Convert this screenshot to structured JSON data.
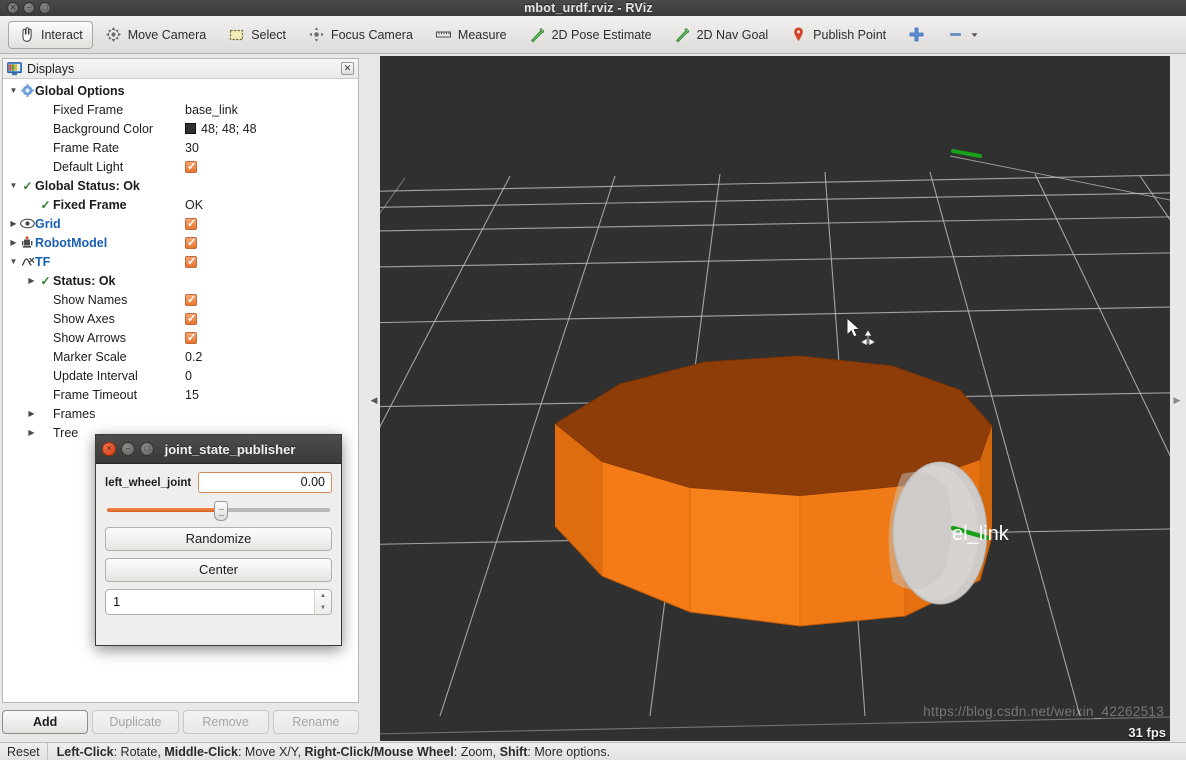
{
  "window": {
    "title": "mbot_urdf.rviz - RViz",
    "buttons": [
      "close",
      "minimize",
      "maximize"
    ]
  },
  "toolbar": {
    "items": [
      {
        "label": "Interact",
        "icon": "hand-cursor-icon",
        "active": true
      },
      {
        "label": "Move Camera",
        "icon": "move-camera-icon",
        "active": false
      },
      {
        "label": "Select",
        "icon": "select-rect-icon",
        "active": false
      },
      {
        "label": "Focus Camera",
        "icon": "focus-camera-icon",
        "active": false
      },
      {
        "label": "Measure",
        "icon": "measure-ruler-icon",
        "active": false
      },
      {
        "label": "2D Pose Estimate",
        "icon": "pose-arrow-icon",
        "active": false
      },
      {
        "label": "2D Nav Goal",
        "icon": "nav-goal-arrow-icon",
        "active": false
      },
      {
        "label": "Publish Point",
        "icon": "map-pin-icon",
        "active": false
      },
      {
        "label": "",
        "icon": "plus-cross-icon",
        "active": false
      },
      {
        "label": "",
        "icon": "toolbar-overflow-icon",
        "active": false
      }
    ]
  },
  "displays": {
    "title": "Displays",
    "close_glyph": "✕",
    "rows": [
      {
        "indent": 0,
        "arrow": "▼",
        "icon": "gear-icon",
        "label": "Global Options",
        "value_type": "none",
        "value": "",
        "style": "bold"
      },
      {
        "indent": 1,
        "arrow": "",
        "icon": "",
        "label": "Fixed Frame",
        "value_type": "text",
        "value": "base_link",
        "style": ""
      },
      {
        "indent": 1,
        "arrow": "",
        "icon": "",
        "label": "Background Color",
        "value_type": "swatch",
        "value": "48; 48; 48",
        "style": "",
        "color": "#303030"
      },
      {
        "indent": 1,
        "arrow": "",
        "icon": "",
        "label": "Frame Rate",
        "value_type": "text",
        "value": "30",
        "style": ""
      },
      {
        "indent": 1,
        "arrow": "",
        "icon": "",
        "label": "Default Light",
        "value_type": "checkbox",
        "value": "",
        "style": ""
      },
      {
        "indent": 0,
        "arrow": "▼",
        "icon": "check-icon",
        "label": "Global Status: Ok",
        "value_type": "none",
        "value": "",
        "style": "bold"
      },
      {
        "indent": 1,
        "arrow": "",
        "icon": "check-icon",
        "label": "Fixed Frame",
        "value_type": "text",
        "value": "OK",
        "style": "bold"
      },
      {
        "indent": 0,
        "arrow": "▶",
        "icon": "eye-icon",
        "label": "Grid",
        "value_type": "checkbox",
        "value": "",
        "style": "blue"
      },
      {
        "indent": 0,
        "arrow": "▶",
        "icon": "robot-icon",
        "label": "RobotModel",
        "value_type": "checkbox",
        "value": "",
        "style": "blue"
      },
      {
        "indent": 0,
        "arrow": "▼",
        "icon": "tf-icon",
        "label": "TF",
        "value_type": "checkbox",
        "value": "",
        "style": "blue"
      },
      {
        "indent": 1,
        "arrow": "▶",
        "icon": "check-icon",
        "label": "Status: Ok",
        "value_type": "none",
        "value": "",
        "style": "bold"
      },
      {
        "indent": 1,
        "arrow": "",
        "icon": "",
        "label": "Show Names",
        "value_type": "checkbox",
        "value": "",
        "style": ""
      },
      {
        "indent": 1,
        "arrow": "",
        "icon": "",
        "label": "Show Axes",
        "value_type": "checkbox",
        "value": "",
        "style": ""
      },
      {
        "indent": 1,
        "arrow": "",
        "icon": "",
        "label": "Show Arrows",
        "value_type": "checkbox",
        "value": "",
        "style": ""
      },
      {
        "indent": 1,
        "arrow": "",
        "icon": "",
        "label": "Marker Scale",
        "value_type": "text",
        "value": "0.2",
        "style": ""
      },
      {
        "indent": 1,
        "arrow": "",
        "icon": "",
        "label": "Update Interval",
        "value_type": "text",
        "value": "0",
        "style": ""
      },
      {
        "indent": 1,
        "arrow": "",
        "icon": "",
        "label": "Frame Timeout",
        "value_type": "text",
        "value": "15",
        "style": ""
      },
      {
        "indent": 1,
        "arrow": "▶",
        "icon": "",
        "label": "Frames",
        "value_type": "none",
        "value": "",
        "style": ""
      },
      {
        "indent": 1,
        "arrow": "▶",
        "icon": "",
        "label": "Tree",
        "value_type": "none",
        "value": "",
        "style": ""
      }
    ],
    "buttons": [
      {
        "label": "Add",
        "enabled": true
      },
      {
        "label": "Duplicate",
        "enabled": false
      },
      {
        "label": "Remove",
        "enabled": false
      },
      {
        "label": "Rename",
        "enabled": false
      }
    ]
  },
  "joint_state_publisher": {
    "title": "joint_state_publisher",
    "joint_label": "left_wheel_joint",
    "joint_value": "0.00",
    "slider_percent": 51,
    "randomize_label": "Randomize",
    "center_label": "Center",
    "spin_value": "1"
  },
  "view3d": {
    "tf_frame_label": "el_link",
    "fps": "31 fps",
    "watermark": "https://blog.csdn.net/weixin_42262513",
    "background_color": "#303030",
    "grid_color": "#bfbfbf",
    "body_color": "#f07818",
    "body_top_color": "#8f3d08",
    "wheel_color": "#c9c6c3",
    "axis_color": "#18a018"
  },
  "statusbar": {
    "reset_label": "Reset",
    "hints": [
      {
        "bold": "Left-Click",
        "text": ": Rotate,  "
      },
      {
        "bold": "Middle-Click",
        "text": ": Move X/Y,  "
      },
      {
        "bold": "Right-Click/Mouse Wheel",
        "text": ": Zoom,  "
      },
      {
        "bold": "Shift",
        "text": ": More options."
      }
    ]
  }
}
